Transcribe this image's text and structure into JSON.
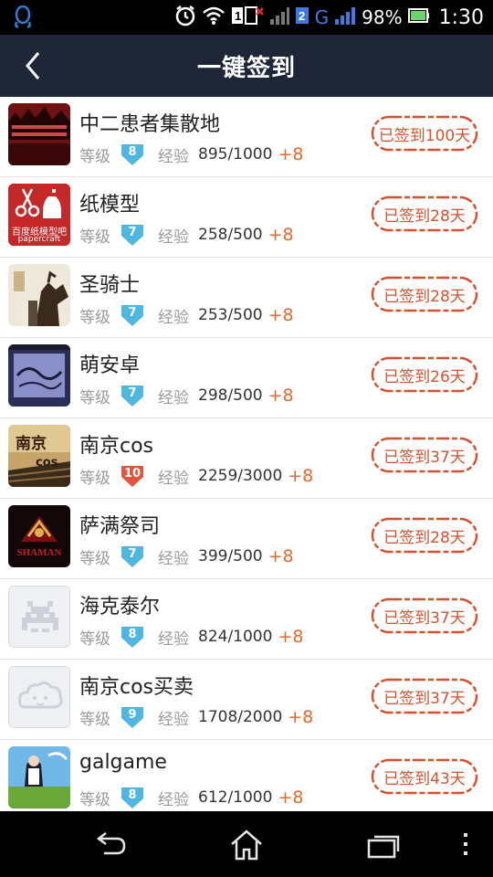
{
  "status": {
    "battery": "98%",
    "time": "1:30",
    "sim1": "1",
    "sim2": "2",
    "network": "G"
  },
  "header": {
    "title": "一键签到"
  },
  "labels": {
    "level": "等级",
    "exp": "经验"
  },
  "colors": {
    "level_blue": "#4fb6e0",
    "level_red": "#e2553a",
    "accent": "#e8682a",
    "stamp_red": "#d9512c",
    "title_bg": "#1e2638"
  },
  "forums": [
    {
      "name": "中二患者集散地",
      "level": "8",
      "exp": "895/1000",
      "gain": "+8",
      "signed": "已签到100天",
      "level_color": "blue"
    },
    {
      "name": "纸模型",
      "level": "7",
      "exp": "258/500",
      "gain": "+8",
      "signed": "已签到28天",
      "level_color": "blue",
      "avatar_text": "百度纸模型吧",
      "avatar_sub": "papercraft"
    },
    {
      "name": "圣骑士",
      "level": "7",
      "exp": "253/500",
      "gain": "+8",
      "signed": "已签到28天",
      "level_color": "blue"
    },
    {
      "name": "萌安卓",
      "level": "7",
      "exp": "298/500",
      "gain": "+8",
      "signed": "已签到26天",
      "level_color": "blue"
    },
    {
      "name": "南京cos",
      "level": "10",
      "exp": "2259/3000",
      "gain": "+8",
      "signed": "已签到37天",
      "level_color": "red",
      "avatar_text": "南京",
      "avatar_sub": "cos"
    },
    {
      "name": "萨满祭司",
      "level": "7",
      "exp": "399/500",
      "gain": "+8",
      "signed": "已签到28天",
      "level_color": "blue",
      "avatar_sub": "SHAMAN"
    },
    {
      "name": "海克泰尔",
      "level": "8",
      "exp": "824/1000",
      "gain": "+8",
      "signed": "已签到37天",
      "level_color": "blue"
    },
    {
      "name": "南京cos买卖",
      "level": "9",
      "exp": "1708/2000",
      "gain": "+8",
      "signed": "已签到37天",
      "level_color": "blue"
    },
    {
      "name": "galgame",
      "level": "8",
      "exp": "612/1000",
      "gain": "+8",
      "signed": "已签到43天",
      "level_color": "blue"
    }
  ],
  "nav": {
    "back": "back-icon",
    "home": "home-icon",
    "recents": "recents-icon",
    "menu": "overflow-menu-icon"
  }
}
